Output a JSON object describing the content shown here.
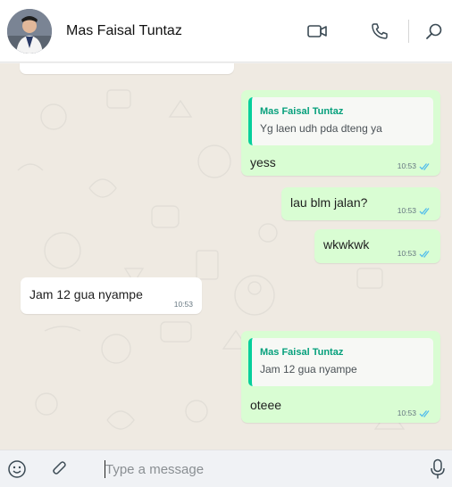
{
  "header": {
    "contact_name": "Mas Faisal Tuntaz",
    "icons": [
      "avatar",
      "video-call-icon",
      "voice-call-icon",
      "search-icon"
    ]
  },
  "messages": [
    {
      "direction": "out",
      "quote_author": "Mas Faisal Tuntaz",
      "quote_text": "Yg laen udh pda dteng ya",
      "text": "yess",
      "time": "10:53",
      "status": "read"
    },
    {
      "direction": "out",
      "text": "lau blm jalan?",
      "time": "10:53",
      "status": "read"
    },
    {
      "direction": "out",
      "text": "wkwkwk",
      "time": "10:53",
      "status": "read"
    },
    {
      "direction": "in",
      "text": "Jam 12 gua nyampe",
      "time": "10:53"
    },
    {
      "direction": "out",
      "quote_author": "Mas Faisal Tuntaz",
      "quote_text": "Jam 12 gua nyampe",
      "text": "oteee",
      "time": "10:53",
      "status": "read"
    }
  ],
  "composer": {
    "placeholder": "Type a message",
    "icons": [
      "emoji-icon",
      "attach-icon",
      "microphone-icon"
    ]
  },
  "colors": {
    "outgoing_bubble": "#d9fdd3",
    "incoming_bubble": "#ffffff",
    "quote_accent": "#06cf9c",
    "read_ticks": "#53bdeb",
    "chat_background": "#efeae2"
  }
}
